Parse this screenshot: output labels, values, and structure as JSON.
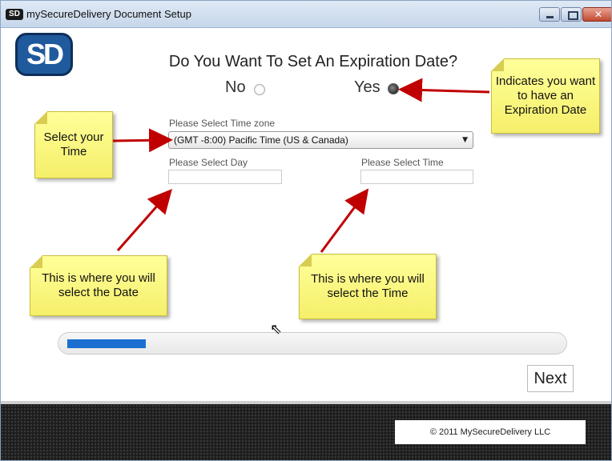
{
  "window": {
    "title": "mySecureDelivery Document Setup",
    "title_logo": "SD"
  },
  "logo": {
    "text": "SD"
  },
  "question": "Do You Want To Set An Expiration Date?",
  "options": {
    "no": "No",
    "yes": "Yes",
    "selected": "yes"
  },
  "timezone": {
    "label": "Please Select Time zone",
    "value": "(GMT -8:00) Pacific Time (US & Canada)"
  },
  "day": {
    "label": "Please Select Day",
    "value": ""
  },
  "time": {
    "label": "Please Select Time",
    "value": ""
  },
  "notes": {
    "expiration": "Indicates you want to have an Expiration Date",
    "time_zone": "Select your Time",
    "date": "This is where you will select the Date",
    "time": "This is where you will select the Time"
  },
  "progress": {
    "fraction": 0.16
  },
  "next_label": "Next",
  "footer": {
    "copyright": "© 2011 MySecureDelivery LLC"
  },
  "colors": {
    "accent": "#1a6fd1",
    "note": "#ffff9a",
    "arrow": "#c00000"
  },
  "icons": {
    "cursor": "mouse-pointer-icon",
    "dropdown": "chevron-down-icon"
  }
}
